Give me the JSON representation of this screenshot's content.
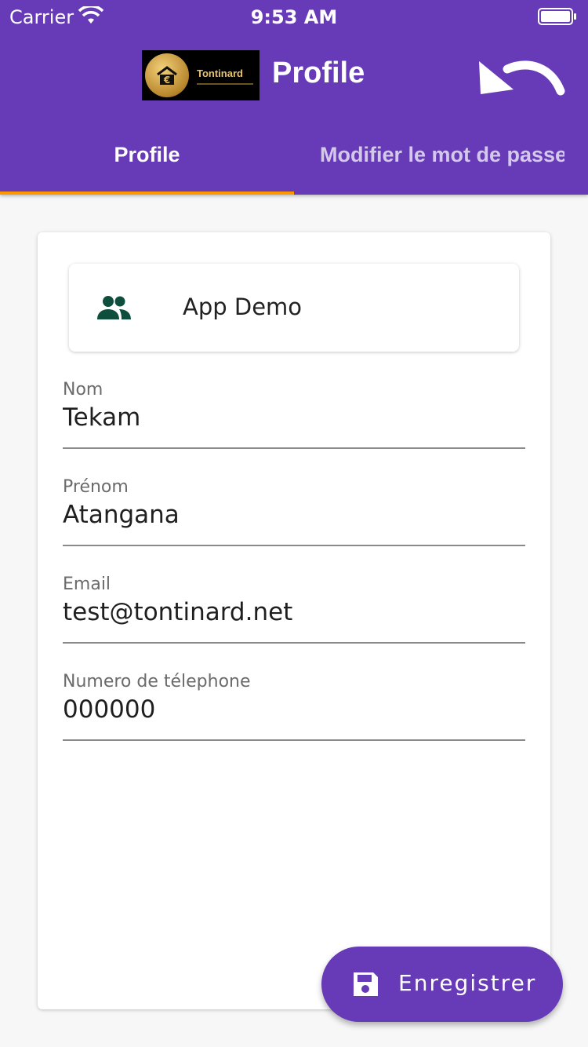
{
  "status_bar": {
    "carrier": "Carrier",
    "time": "9:53 AM",
    "wifi_icon": "wifi-icon",
    "battery_icon": "battery-icon"
  },
  "header": {
    "logo_text": "Tontinard",
    "title": "Profile",
    "back_icon": "undo-arrow-icon"
  },
  "tabs": [
    {
      "label": "Profile",
      "active": true
    },
    {
      "label": "Modifier le mot de passe",
      "active": false
    }
  ],
  "account": {
    "icon": "group-icon",
    "name": "App Demo"
  },
  "form": {
    "fields": [
      {
        "label": "Nom",
        "value": "Tekam"
      },
      {
        "label": "Prénom",
        "value": "Atangana"
      },
      {
        "label": "Email",
        "value": "test@tontinard.net"
      },
      {
        "label": "Numero de télephone",
        "value": "000000"
      }
    ]
  },
  "save_button": {
    "icon": "save-icon",
    "label": "Enregistrer"
  },
  "colors": {
    "primary": "#673ab7",
    "tab_indicator": "#ff9800",
    "icon_green": "#0d4f3c",
    "background": "#f7f7f7"
  }
}
